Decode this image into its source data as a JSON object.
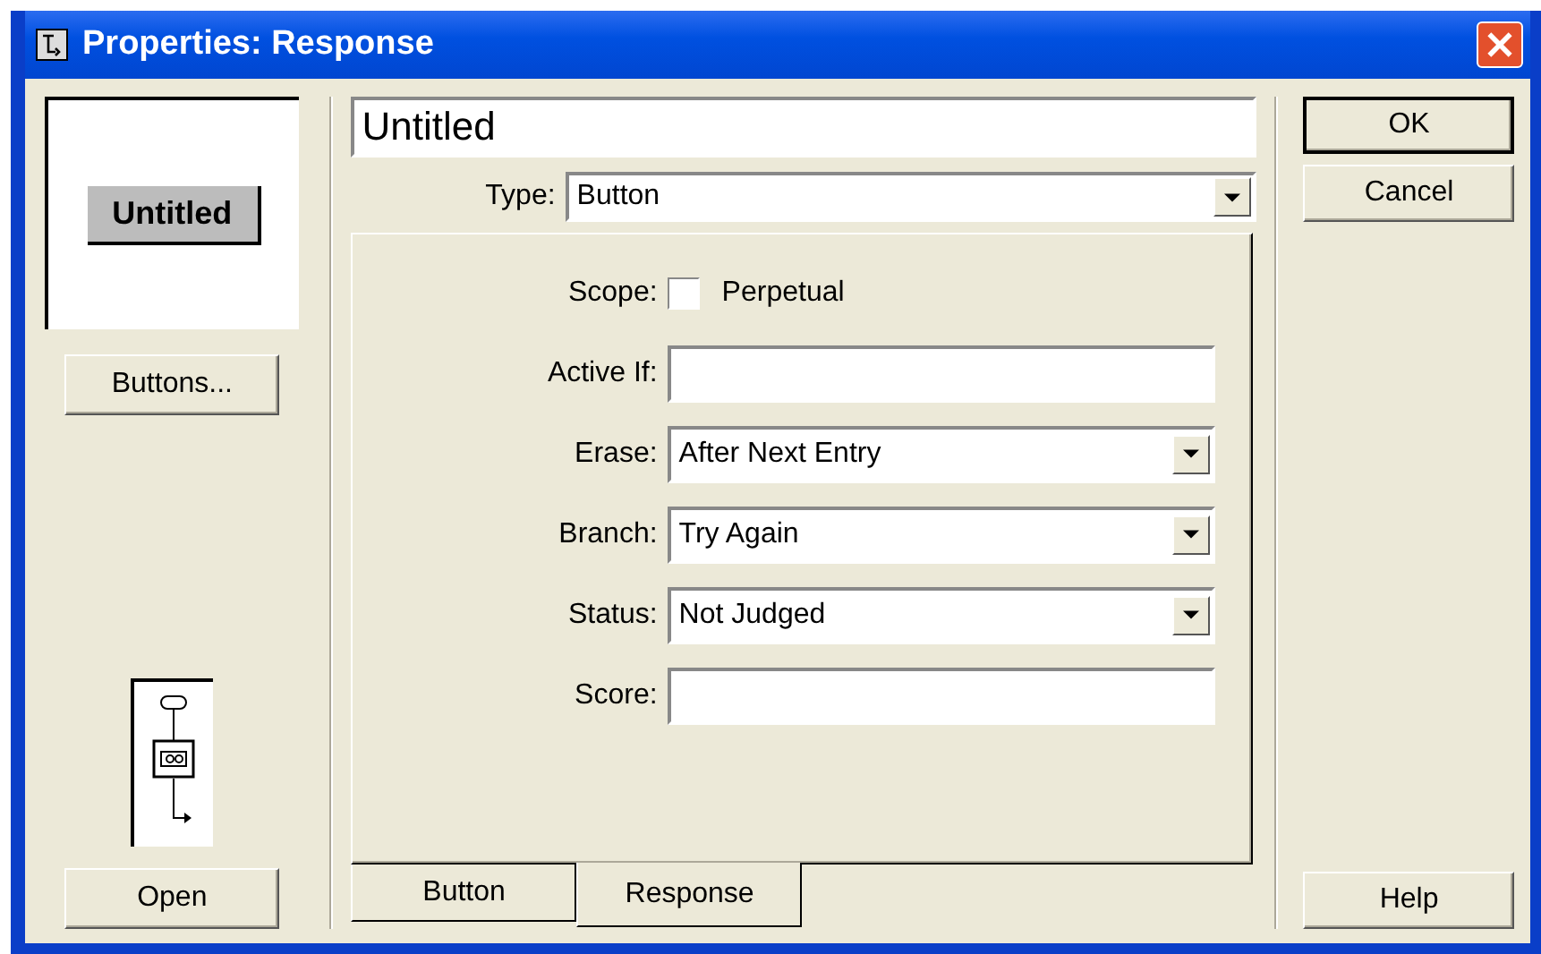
{
  "window": {
    "title": "Properties: Response"
  },
  "preview": {
    "label": "Untitled"
  },
  "left_buttons": [
    "Buttons...",
    "Open"
  ],
  "name_field": {
    "value": "Untitled"
  },
  "type": {
    "label": "Type:",
    "value": "Button"
  },
  "fields": [
    {
      "kind": "checkbox",
      "label": "Scope:",
      "option": "Perpetual",
      "checked": false
    },
    {
      "kind": "text",
      "label": "Active If:"
    },
    {
      "kind": "dropdown",
      "label": "Erase:",
      "value": "After Next Entry"
    },
    {
      "kind": "dropdown",
      "label": "Branch:",
      "value": "Try Again"
    },
    {
      "kind": "dropdown",
      "label": "Status:",
      "value": "Not Judged"
    },
    {
      "kind": "text",
      "label": "Score:"
    }
  ],
  "tabs": [
    {
      "label": "Button",
      "selected": false
    },
    {
      "label": "Response",
      "selected": true
    }
  ],
  "right_buttons": [
    "OK",
    "Cancel"
  ],
  "help_button": "Help"
}
